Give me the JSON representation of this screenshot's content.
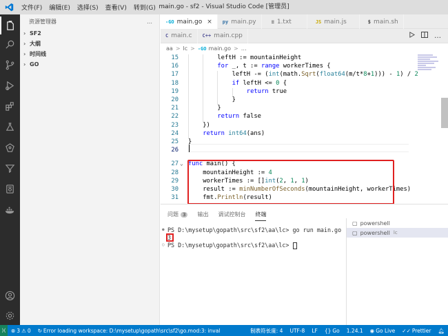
{
  "menu": [
    "文件(F)",
    "编辑(E)",
    "选择(S)",
    "查看(V)",
    "转到(G)",
    "…"
  ],
  "window_title": "main.go - sf2 - Visual Studio Code [管理员]",
  "sidebar": {
    "title": "资源管理器",
    "more": "…",
    "sections": [
      {
        "label": "SF2",
        "icon": "chevron-right-icon"
      },
      {
        "label": "大纲",
        "icon": "chevron-right-icon"
      },
      {
        "label": "时间线",
        "icon": "chevron-right-icon"
      },
      {
        "label": "GO",
        "icon": "chevron-right-icon"
      }
    ]
  },
  "tabs_row1": [
    {
      "icon": "-GO",
      "label": "main.go",
      "close": "×"
    },
    {
      "icon": "py",
      "label": "main.py"
    },
    {
      "icon": "≡",
      "label": "1.txt"
    },
    {
      "icon": "JS",
      "label": "main.js"
    },
    {
      "icon": "$",
      "label": "main.sh"
    }
  ],
  "tabs_row2": [
    {
      "icon": "C",
      "label": "main.c"
    },
    {
      "icon": "C++",
      "label": "main.cpp"
    }
  ],
  "breadcrumb": {
    "parts": [
      "aa",
      "lc",
      "main.go"
    ],
    "file_icon": "-GO",
    "separator": ">"
  },
  "editor": {
    "lines": [
      {
        "n": "15",
        "indent": 2,
        "code": "leftH := mountainHeight"
      },
      {
        "n": "16",
        "indent": 2,
        "code": "for _, t := range workerTimes {"
      },
      {
        "n": "17",
        "indent": 3,
        "code": "leftH -= (int(math.Sqrt(float64(m/t*8+1))) - 1) / 2"
      },
      {
        "n": "18",
        "indent": 3,
        "code": "if leftH <= 0 {"
      },
      {
        "n": "19",
        "indent": 4,
        "code": "return true"
      },
      {
        "n": "20",
        "indent": 3,
        "code": "}"
      },
      {
        "n": "21",
        "indent": 2,
        "code": "}"
      },
      {
        "n": "22",
        "indent": 2,
        "code": "return false"
      },
      {
        "n": "23",
        "indent": 1,
        "code": "})"
      },
      {
        "n": "24",
        "indent": 1,
        "code": "return int64(ans)"
      },
      {
        "n": "25",
        "indent": 0,
        "code": "}"
      },
      {
        "n": "26",
        "indent": 0,
        "code": ""
      },
      {
        "n": "27",
        "indent": 0,
        "code": "func main() {"
      },
      {
        "n": "28",
        "indent": 1,
        "code": "mountainHeight := 4"
      },
      {
        "n": "29",
        "indent": 1,
        "code": "workerTimes := []int(2, 1, 1)"
      },
      {
        "n": "30",
        "indent": 1,
        "code": "result := minNumberOfSeconds(mountainHeight, workerTimes)"
      },
      {
        "n": "31",
        "indent": 1,
        "code": "fmt.Println(result)"
      }
    ],
    "current_line": "26"
  },
  "panel": {
    "tabs": [
      "问题",
      "输出",
      "调试控制台",
      "终端"
    ],
    "problems_count": "3",
    "terminal_lines": [
      "PS D:\\mysetup\\gopath\\src\\sf2\\aa\\lc> go run main.go",
      "3",
      "PS D:\\mysetup\\gopath\\src\\sf2\\aa\\lc> "
    ],
    "terminals": [
      {
        "label": "powershell",
        "sub": ""
      },
      {
        "label": "powershell",
        "sub": "lc"
      }
    ]
  },
  "statusbar": {
    "errors": "3",
    "warnings": "0",
    "message": "Error loading workspace: D:\\mysetup\\gopath\\src\\sf2\\go.mod:3: invalid g",
    "tab_size": "制表符长度: 4",
    "encoding": "UTF-8",
    "eol": "LF",
    "language": "Go",
    "go_version": "1.24.1",
    "go_live": "Go Live",
    "prettier": "Prettier"
  },
  "colors": {
    "statusbar": "#007acc",
    "activitybar": "#2c2c2c",
    "highlight_box": "#e02020",
    "keyword": "#0000ff",
    "number": "#098658",
    "function": "#795e26"
  }
}
